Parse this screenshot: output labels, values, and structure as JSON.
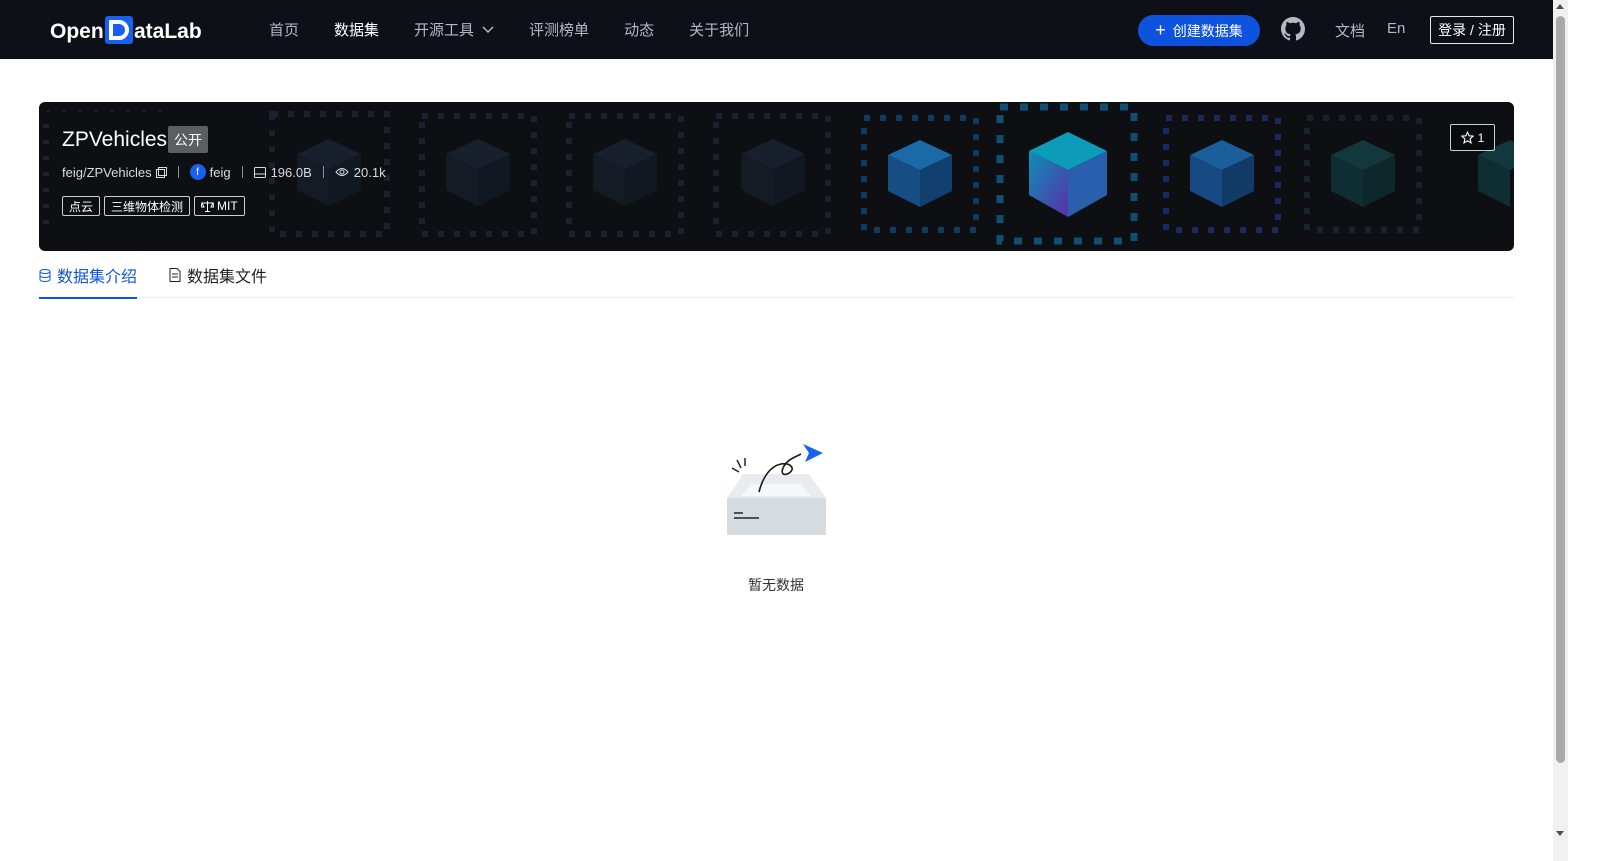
{
  "header": {
    "logo_text": "OpenDataLab",
    "nav": [
      {
        "label": "首页"
      },
      {
        "label": "数据集"
      },
      {
        "label": "开源工具"
      },
      {
        "label": "评测榜单"
      },
      {
        "label": "动态"
      },
      {
        "label": "关于我们"
      }
    ],
    "active_nav": "数据集",
    "create_button": "创建数据集",
    "docs": "文档",
    "lang": "En",
    "login": "登录 / 注册"
  },
  "dataset": {
    "title": "ZPVehicles",
    "visibility": "公开",
    "repo_path": "feig/ZPVehicles",
    "owner_initial": "f",
    "owner": "feig",
    "size": "196.0B",
    "views": "20.1k",
    "tags": [
      "点云",
      "三维物体检测"
    ],
    "license": "MIT",
    "stars": "1"
  },
  "tabs": {
    "intro": "数据集介绍",
    "files": "数据集文件",
    "active": "数据集介绍"
  },
  "empty": {
    "text": "暂无数据"
  },
  "colors": {
    "brand_blue": "#0d53de",
    "topbar_bg": "#0d1117",
    "banner_bg": "#0e0f12"
  }
}
